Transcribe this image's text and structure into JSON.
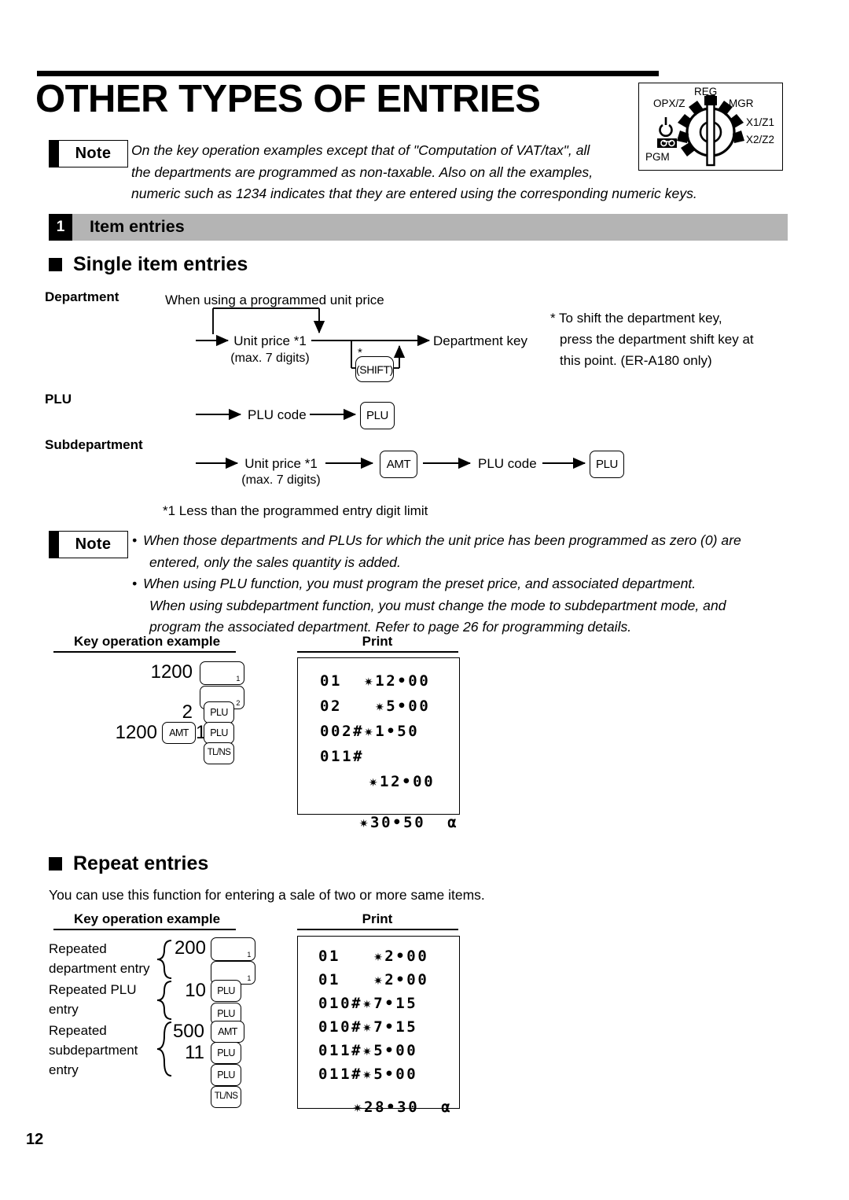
{
  "page": {
    "title": "OTHER TYPES OF ENTRIES",
    "page_number": "12"
  },
  "mode_dial": {
    "labels": {
      "reg": "REG",
      "mgr": "MGR",
      "opxz": "OPX/Z",
      "x1z1": "X1/Z1",
      "x2z2": "X2/Z2",
      "pgm": "PGM"
    },
    "icons": [
      "power-icon",
      "key-icon"
    ]
  },
  "note_top": {
    "label": "Note",
    "text": "On the key operation examples except that of \"Computation of VAT/tax\", all the departments are programmed as non-taxable.  Also on all the examples, numeric such as 1234 indicates that they are entered using the corresponding numeric keys.",
    "lines": [
      "On the key operation examples except that of \"Computation of VAT/tax\", all",
      "the departments are programmed as non-taxable.  Also on all the examples,",
      "numeric such as 1234 indicates that they are entered using the corresponding numeric keys."
    ]
  },
  "section": {
    "number": "1",
    "heading": "Item entries"
  },
  "single_item": {
    "heading": "Single item entries",
    "department": {
      "label": "Department",
      "caption": "When using a programmed unit price",
      "unit_price": "Unit price *1",
      "unit_price_sub": "(max. 7 digits)",
      "shift_key": "SHIFT",
      "shift_star": "*",
      "dept_key": "Department key",
      "footnote": "* To shift the department key, press the department shift key at this point. (ER-A180 only)",
      "footnote_lines": [
        "* To shift the department key,",
        "press the department shift key at",
        "this point. (ER-A180 only)"
      ]
    },
    "plu": {
      "label": "PLU",
      "code": "PLU code",
      "key": "PLU"
    },
    "subdepartment": {
      "label": "Subdepartment",
      "unit_price": "Unit price *1",
      "unit_price_sub": "(max. 7 digits)",
      "amt_key": "AMT",
      "code": "PLU code",
      "plu_key": "PLU"
    },
    "footnote1": "*1 Less than the programmed entry digit limit"
  },
  "note_bottom": {
    "label": "Note",
    "bullets": [
      {
        "lines": [
          "When those departments and PLUs for which the unit price has been programmed as zero (0) are",
          "entered, only the sales quantity is added."
        ]
      },
      {
        "lines": [
          "When using PLU function, you must program the preset price, and associated department.",
          "When using subdepartment function, you must change the mode to subdepartment mode, and",
          "program the associated department.  Refer to page 26 for programming details."
        ]
      }
    ]
  },
  "example1": {
    "col_key": "Key operation example",
    "col_print": "Print",
    "keys": [
      {
        "num": "1200",
        "key": "",
        "key_sub": "1",
        "type": "dept"
      },
      {
        "num": "",
        "key": "",
        "key_sub": "2",
        "type": "dept"
      },
      {
        "num": "2",
        "key": "PLU",
        "type": "plu"
      },
      {
        "num": "1200",
        "key2": "AMT",
        "num2": "11",
        "key": "PLU",
        "type": "amt-plu"
      },
      {
        "num": "",
        "key": "TL/NS",
        "type": "tlns"
      }
    ],
    "print_lines": [
      "01  *12•0 0",
      "02   *5•0 0",
      "002#*1•5 0",
      "011#",
      "    *12•0 0",
      "",
      "    *30•50  α"
    ],
    "print_rows": [
      {
        "text": "01  ✷12•00",
        "indent": 0
      },
      {
        "text": "02   ✷5•00",
        "indent": 0
      },
      {
        "text": "002#✷1•50",
        "indent": 0
      },
      {
        "text": "011#",
        "indent": 0
      },
      {
        "text": "✷12•00",
        "indent": 62
      },
      {
        "text": "✷30•50  α",
        "indent": 50
      }
    ]
  },
  "repeat": {
    "heading": "Repeat entries",
    "intro": "You can use this function for entering a sale of two or more same items.",
    "col_key": "Key operation example",
    "col_print": "Print",
    "groups": [
      {
        "label_lines": [
          "Repeated",
          "department entry"
        ]
      },
      {
        "label_lines": [
          "Repeated PLU",
          "entry"
        ]
      },
      {
        "label_lines": [
          "Repeated",
          "subdepartment",
          "entry"
        ]
      }
    ],
    "keys": [
      {
        "num": "200",
        "key": "",
        "key_sub": "1",
        "type": "dept"
      },
      {
        "num": "",
        "key": "",
        "key_sub": "1",
        "type": "dept"
      },
      {
        "num": "10",
        "key": "PLU",
        "type": "plu"
      },
      {
        "num": "",
        "key": "PLU",
        "type": "plu"
      },
      {
        "num": "500",
        "key": "AMT",
        "type": "amt"
      },
      {
        "num": "11",
        "key": "PLU",
        "type": "plu"
      },
      {
        "num": "",
        "key": "PLU",
        "type": "plu"
      },
      {
        "num": "",
        "key": "TL/NS",
        "type": "tlns"
      }
    ],
    "print_rows": [
      {
        "text": "01   ✷2•00",
        "indent": 0
      },
      {
        "text": "01   ✷2•00",
        "indent": 0
      },
      {
        "text": "010#✷7•15",
        "indent": 0
      },
      {
        "text": "010#✷7•15",
        "indent": 0
      },
      {
        "text": "011#✷5•00",
        "indent": 0
      },
      {
        "text": "011#✷5•00",
        "indent": 0
      },
      {
        "text": "✷28•30  α",
        "indent": 44
      }
    ]
  }
}
